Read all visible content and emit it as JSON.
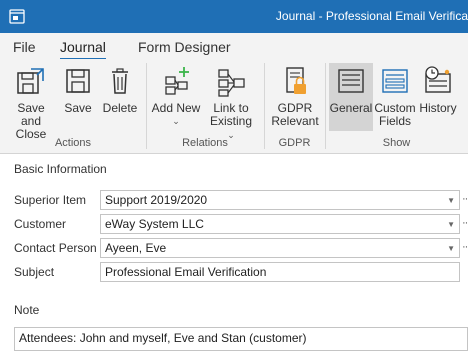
{
  "window": {
    "title": "Journal - Professional Email Verifica"
  },
  "menu": {
    "tabs": [
      "File",
      "Journal",
      "Form Designer"
    ],
    "active": "Journal"
  },
  "ribbon": {
    "buttons": {
      "save_close": {
        "line1": "Save and",
        "line2": "Close"
      },
      "save": {
        "label": "Save"
      },
      "delete": {
        "label": "Delete"
      },
      "add_new": {
        "label": "Add New"
      },
      "link_existing": {
        "line1": "Link to",
        "line2": "Existing"
      },
      "gdpr_relevant": {
        "line1": "GDPR",
        "line2": "Relevant"
      },
      "general": {
        "label": "General"
      },
      "custom_fields": {
        "line1": "Custom",
        "line2": "Fields"
      },
      "history": {
        "label": "History"
      }
    },
    "groups": {
      "actions": "Actions",
      "relations": "Relations",
      "gdpr": "GDPR",
      "show": "Show"
    }
  },
  "form": {
    "section_title": "Basic Information",
    "fields": {
      "superior_item": {
        "label": "Superior Item",
        "value": "Support 2019/2020"
      },
      "customer": {
        "label": "Customer",
        "value": "eWay System LLC"
      },
      "contact_person": {
        "label": "Contact Person",
        "value": "Ayeen, Eve"
      },
      "subject": {
        "label": "Subject",
        "value": "Professional Email Verification"
      }
    },
    "note": {
      "label": "Note",
      "value": "Attendees: John and myself, Eve and Stan (customer)"
    }
  },
  "colors": {
    "titlebar": "#1f6fb5",
    "ribbon_bg": "#f3f3f3",
    "selected": "#d4d4d4",
    "accent_green": "#3bb54a",
    "accent_orange": "#f0a030"
  }
}
